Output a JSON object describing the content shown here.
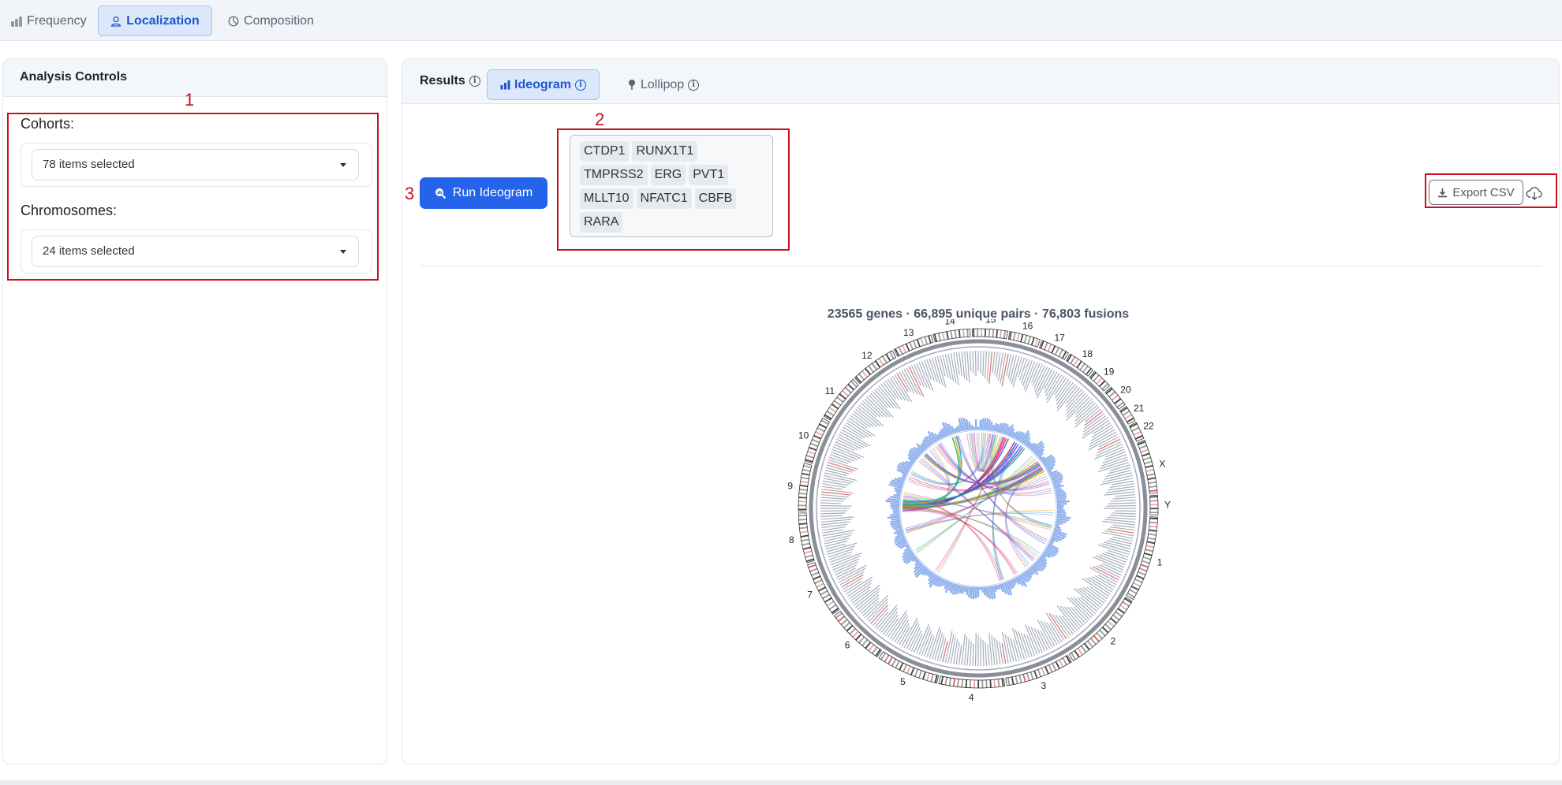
{
  "top_tabs": [
    {
      "label": "Frequency",
      "icon": "bar-chart-icon",
      "active": false
    },
    {
      "label": "Localization",
      "icon": "person-pin-icon",
      "active": true
    },
    {
      "label": "Composition",
      "icon": "pie-chart-icon",
      "active": false
    }
  ],
  "left_panel": {
    "title": "Analysis Controls",
    "cohorts": {
      "label": "Cohorts:",
      "value": "78 items selected"
    },
    "chromosomes": {
      "label": "Chromosomes:",
      "value": "24 items selected"
    }
  },
  "results": {
    "label": "Results",
    "tabs": [
      {
        "label": "Ideogram",
        "icon": "bar-chart-icon",
        "active": true
      },
      {
        "label": "Lollipop",
        "icon": "lollipop-icon",
        "active": false
      }
    ],
    "run_button": "Run Ideogram",
    "genes": [
      "CTDP1",
      "RUNX1T1",
      "TMPRSS2",
      "ERG",
      "PVT1",
      "MLLT10",
      "NFATC1",
      "CBFB",
      "RARA"
    ],
    "export_button": "Export CSV",
    "stats": "23565 genes  ·  66,895 unique pairs  ·  76,803 fusions"
  },
  "annotations": [
    "1",
    "2",
    "3"
  ],
  "ideogram": {
    "chromosomes": [
      "1",
      "2",
      "3",
      "4",
      "5",
      "6",
      "7",
      "8",
      "9",
      "10",
      "11",
      "12",
      "13",
      "14",
      "15",
      "16",
      "17",
      "18",
      "19",
      "20",
      "21",
      "22",
      "X",
      "Y"
    ],
    "colors": {
      "ideogram_band": "#222222",
      "highlight": "#e03a3a",
      "density": "#8fb0ee",
      "ring": "#6b7280"
    }
  }
}
